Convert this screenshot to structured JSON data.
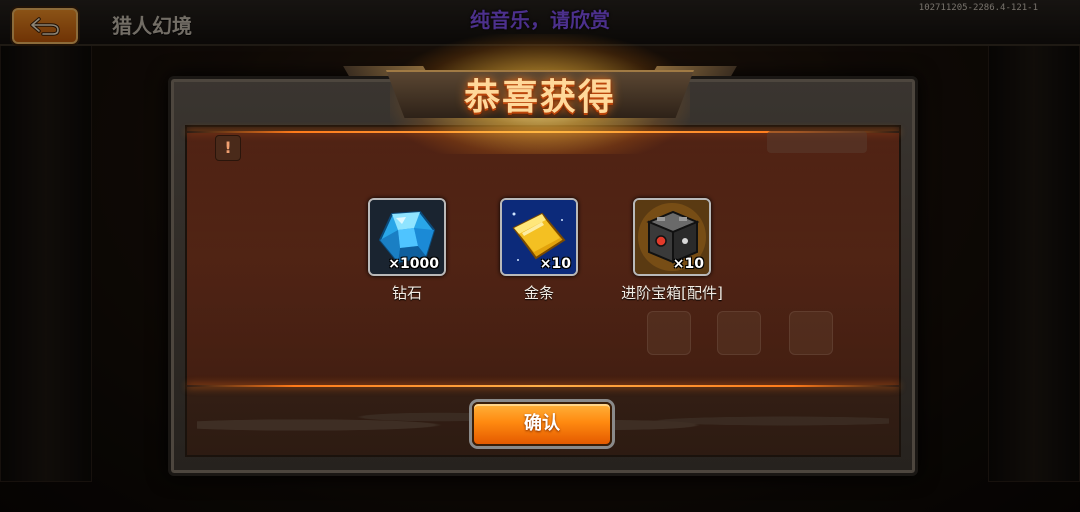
{
  "top_bar": {
    "scene_title": "猎人幻境",
    "back_icon": "back-arrow-icon",
    "music_notice": "纯音乐，请欣赏",
    "build_id": "102711205-2286.4-121-1"
  },
  "dialog": {
    "title": "恭喜获得",
    "rewards": [
      {
        "name": "钻石",
        "quantity": "×1000",
        "icon": "diamond-icon"
      },
      {
        "name": "金条",
        "quantity": "×10",
        "icon": "gold-bar-icon"
      },
      {
        "name": "进阶宝箱[配件]",
        "quantity": "×10",
        "icon": "treasure-box-icon"
      }
    ],
    "confirm_label": "确认"
  },
  "colors": {
    "accent_orange": "#ff8a10",
    "title_gold": "#ffd89a",
    "notice_purple": "#8a58ff"
  }
}
